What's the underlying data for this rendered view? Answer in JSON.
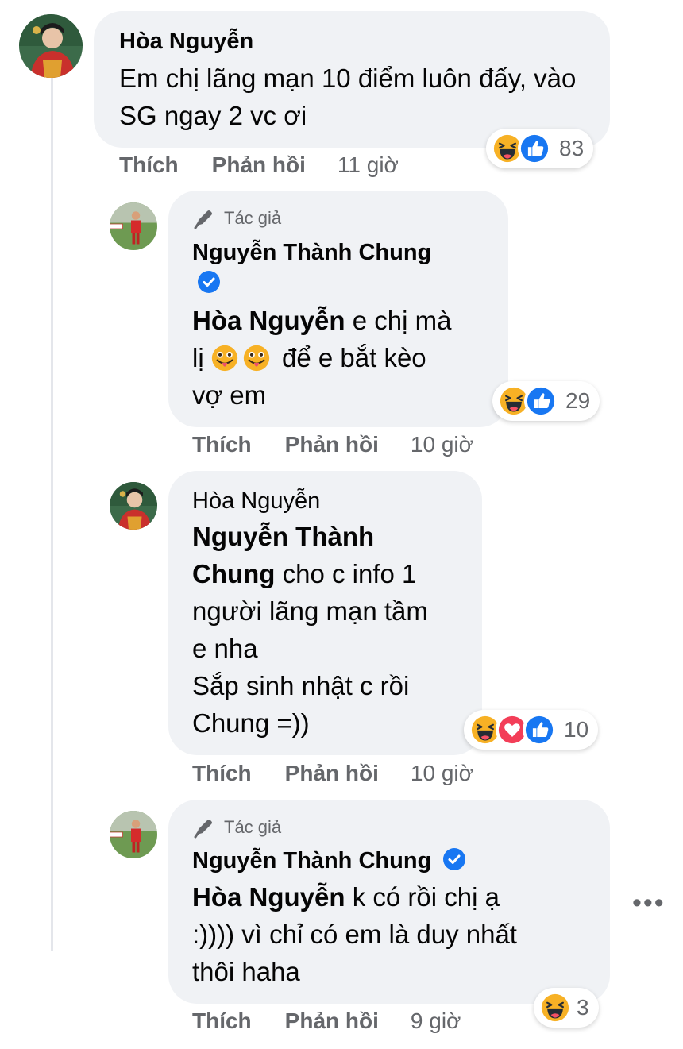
{
  "comments": [
    {
      "author": "Hòa Nguyễn",
      "text": "Em chị lãng mạn 10 điểm luôn đấy, vào SG ngay 2 vc ơi",
      "reaction_count": "83",
      "like_label": "Thích",
      "reply_label": "Phản hồi",
      "time": "11 giờ"
    },
    {
      "author_tag": "Tác giả",
      "author": "Nguyễn Thành Chung",
      "mention": "Hòa Nguyễn",
      "text_lines": [
        "e chị mà",
        "lị",
        "để e bắt kèo",
        "vợ em"
      ],
      "reaction_count": "29",
      "like_label": "Thích",
      "reply_label": "Phản hồi",
      "time": "10 giờ"
    },
    {
      "author": "Hòa Nguyễn",
      "mention_part1": "Nguyễn Thành",
      "mention_part2": "Chung",
      "text_lines": [
        "cho c info 1",
        "người lãng mạn tầm",
        "e nha",
        "Sắp sinh nhật c rồi",
        "Chung =))"
      ],
      "reaction_count": "10",
      "like_label": "Thích",
      "reply_label": "Phản hồi",
      "time": "10 giờ"
    },
    {
      "author_tag": "Tác giả",
      "author": "Nguyễn Thành Chung",
      "mention": "Hòa Nguyễn",
      "text_lines": [
        "k có rồi chị ạ",
        ":)))) vì chỉ có em là duy nhất",
        "thôi haha"
      ],
      "reaction_count": "3",
      "like_label": "Thích",
      "reply_label": "Phản hồi",
      "time": "9 giờ"
    }
  ],
  "more_label": "•••",
  "icons": {
    "haha": "haha-reaction-icon",
    "like": "like-reaction-icon",
    "love": "love-reaction-icon",
    "pencil": "pencil-icon",
    "verified": "verified-badge-icon",
    "tongue": "tongue-out-emoji-icon"
  },
  "colors": {
    "bubble": "#f0f2f5",
    "like_blue": "#1877f2",
    "love_red": "#f33e58",
    "haha_yellow": "#f7b125",
    "muted_text": "#65676b"
  }
}
